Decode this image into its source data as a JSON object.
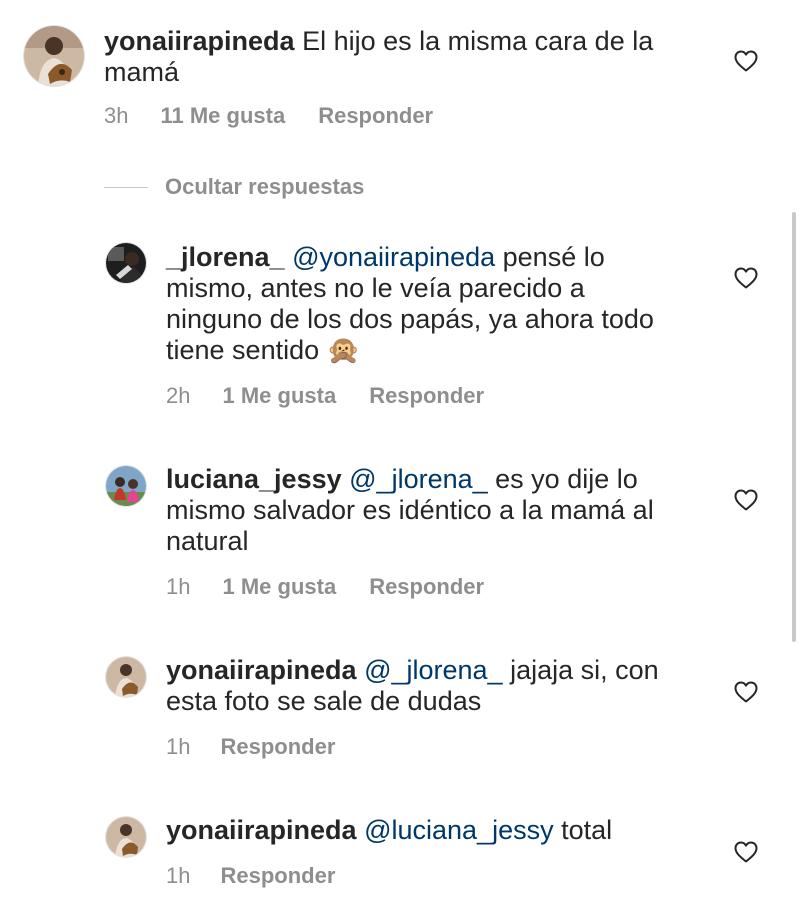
{
  "comments": [
    {
      "username": "yonaiirapineda",
      "mention": "",
      "text": "El hijo es la misma cara de la mamá",
      "emoji": "",
      "time": "3h",
      "likes": "11 Me gusta",
      "reply": "Responder"
    },
    {
      "username": "_jlorena_",
      "mention": "@yonaiirapineda",
      "text": "pensé lo mismo, antes no le veía parecido a ninguno de los dos papás, ya ahora todo tiene sentido",
      "emoji": "🙊",
      "time": "2h",
      "likes": "1 Me gusta",
      "reply": "Responder"
    },
    {
      "username": "luciana_jessy",
      "mention": "@_jlorena_",
      "text": "es yo dije lo mismo salvador es idéntico a la mamá al natural",
      "emoji": "",
      "time": "1h",
      "likes": "1 Me gusta",
      "reply": "Responder"
    },
    {
      "username": "yonaiirapineda",
      "mention": "@_jlorena_",
      "text": "jajaja si, con esta foto se sale de dudas",
      "emoji": "",
      "time": "1h",
      "likes": "",
      "reply": "Responder"
    },
    {
      "username": "yonaiirapineda",
      "mention": "@luciana_jessy",
      "text": "total",
      "emoji": "",
      "time": "1h",
      "likes": "",
      "reply": "Responder"
    }
  ],
  "hide_replies_label": "Ocultar respuestas",
  "icons": {
    "like": "heart-outline-icon",
    "avatar_emoji": "monkey-see-no-evil-emoji"
  },
  "colors": {
    "text": "#262626",
    "secondary": "#8e8e8e",
    "mention": "#00376b",
    "divider": "#c7c7c7"
  }
}
